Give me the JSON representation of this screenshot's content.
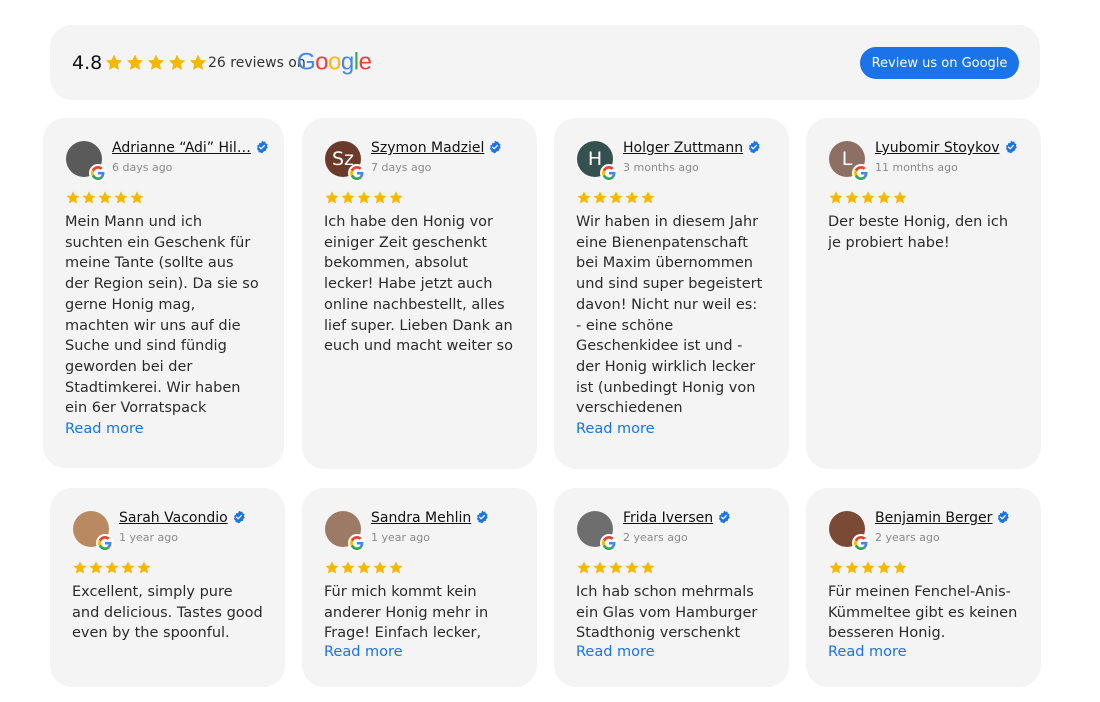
{
  "summary": {
    "rating": "4.8",
    "reviews_text": "26 reviews on",
    "google_letters": [
      {
        "ch": "G",
        "color": "#4285F4"
      },
      {
        "ch": "o",
        "color": "#EA4335"
      },
      {
        "ch": "o",
        "color": "#FBBC05"
      },
      {
        "ch": "g",
        "color": "#4285F4"
      },
      {
        "ch": "l",
        "color": "#34A853"
      },
      {
        "ch": "e",
        "color": "#EA4335"
      }
    ],
    "button_label": "Review us on Google",
    "stars": 5
  },
  "colors": {
    "star": "#F6B700",
    "accent": "#1a73e8",
    "verified": "#1a73e8"
  },
  "read_more_label": "Read more",
  "reviews": [
    {
      "name": "Adrianne “Adi” Hil…",
      "date": "6 days ago",
      "avatar_letter": "",
      "avatar_color": "#5a5a5a",
      "stars": 5,
      "text": "Mein Mann und ich suchten ein Geschenk für meine Tante (sollte aus der Region sein). Da sie so gerne Honig mag, machten wir uns auf die Suche und sind fündig geworden bei der Stadtimkerei. Wir haben ein 6er Vorratspack ausgewählt online, bezahlt und drei Tage",
      "read_more": true
    },
    {
      "name": "Szymon Madziel",
      "date": "7 days ago",
      "avatar_letter": "Sz",
      "avatar_color": "#6b3a2a",
      "stars": 5,
      "text": "Ich habe den Honig vor einiger Zeit geschenkt bekommen, absolut lecker! Habe jetzt auch online nachbestellt, alles lief super. Lieben Dank an euch und macht weiter so",
      "read_more": false
    },
    {
      "name": "Holger Zuttmann",
      "date": "3 months ago",
      "avatar_letter": "H",
      "avatar_color": "#35514f",
      "stars": 5,
      "text": "Wir haben in diesem Jahr eine Bienenpatenschaft bei Maxim übernommen und sind super begeistert davon! Nicht nur weil es: - eine schöne Geschenkidee ist und - der Honig wirklich lecker ist (unbedingt Honig von verschiedenen Standorten probieren), -",
      "read_more": true
    },
    {
      "name": "Lyubomir Stoykov",
      "date": "11 months ago",
      "avatar_letter": "L",
      "avatar_color": "#8d6f64",
      "stars": 5,
      "text": "Der beste Honig, den ich je probiert habe!",
      "read_more": false
    },
    {
      "name": "Sarah Vacondio",
      "date": "1 year ago",
      "avatar_letter": "",
      "avatar_color": "#b98a62",
      "stars": 5,
      "text": "Excellent, simply pure and delicious. Tastes good even by the spoonful.",
      "read_more": false
    },
    {
      "name": "Sandra Mehlin",
      "date": "1 year ago",
      "avatar_letter": "",
      "avatar_color": "#9c7a66",
      "stars": 5,
      "text": "Für mich kommt kein anderer Honig mehr in Frage! Einfach lecker,",
      "read_more": true
    },
    {
      "name": "Frida Iversen",
      "date": "2 years ago",
      "avatar_letter": "",
      "avatar_color": "#6e6e6e",
      "stars": 5,
      "text": "Ich hab schon mehrmals ein Glas vom Hamburger Stadthonig verschenkt und",
      "read_more": true
    },
    {
      "name": "Benjamin Berger",
      "date": "2 years ago",
      "avatar_letter": "",
      "avatar_color": "#7a4a36",
      "stars": 5,
      "text": "Für meinen Fenchel-Anis-Kümmeltee gibt es keinen besseren Honig. Wohltuend,",
      "read_more": true
    }
  ]
}
